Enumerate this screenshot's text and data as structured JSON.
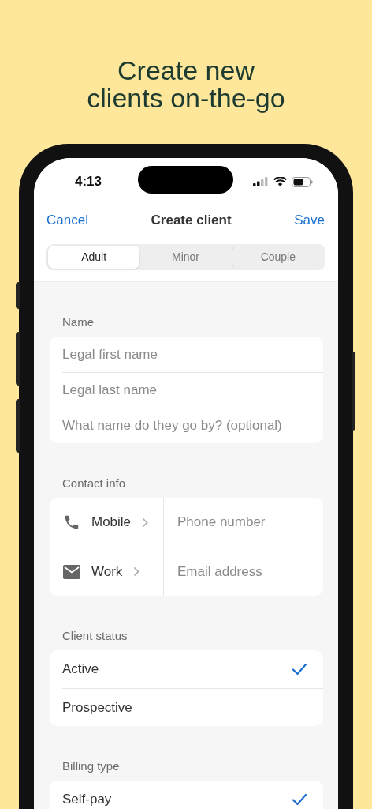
{
  "headline": "Create new\nclients on-the-go",
  "status_bar": {
    "time": "4:13"
  },
  "nav": {
    "cancel": "Cancel",
    "title": "Create client",
    "save": "Save"
  },
  "segments": [
    {
      "label": "Adult",
      "selected": true
    },
    {
      "label": "Minor",
      "selected": false
    },
    {
      "label": "Couple",
      "selected": false
    }
  ],
  "sections": [
    {
      "title": "Name",
      "kind": "fields",
      "fields": [
        {
          "placeholder": "Legal first name"
        },
        {
          "placeholder": "Legal last name"
        },
        {
          "placeholder": "What name do they go by? (optional)"
        }
      ]
    },
    {
      "title": "Contact info",
      "kind": "contact",
      "rows": [
        {
          "kind": "phone",
          "type": "Mobile",
          "placeholder": "Phone number"
        },
        {
          "kind": "mail",
          "type": "Work",
          "placeholder": "Email address"
        }
      ]
    },
    {
      "title": "Client status",
      "kind": "options",
      "options": [
        {
          "label": "Active",
          "selected": true
        },
        {
          "label": "Prospective",
          "selected": false
        }
      ]
    },
    {
      "title": "Billing type",
      "kind": "options",
      "options": [
        {
          "label": "Self-pay",
          "selected": true
        }
      ]
    }
  ]
}
